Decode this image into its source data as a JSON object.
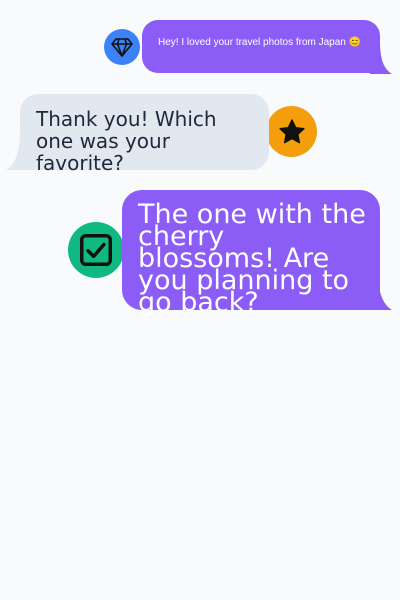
{
  "conversation": {
    "messages": [
      {
        "sender": "me",
        "avatar_icon": "diamond-icon",
        "text": "Hey! I loved your travel photos from Japan 😊",
        "bubble_color": "#8b5cf6",
        "avatar_color": "#3b82f6"
      },
      {
        "sender": "friend",
        "avatar_icon": "star-icon",
        "text": "Thank you! Which one was your favorite?",
        "bubble_color": "#e2e8f0",
        "avatar_color": "#f59e0b"
      },
      {
        "sender": "me",
        "avatar_icon": "checkbox-icon",
        "text": "The one with the cherry blossoms! Are you planning to go back?",
        "bubble_color": "#8b5cf6",
        "avatar_color": "#10b981"
      }
    ]
  },
  "colors": {
    "background": "#f8fafc",
    "outgoing_bubble": "#8b5cf6",
    "incoming_bubble": "#e2e8f0",
    "incoming_text": "#1e293b"
  }
}
